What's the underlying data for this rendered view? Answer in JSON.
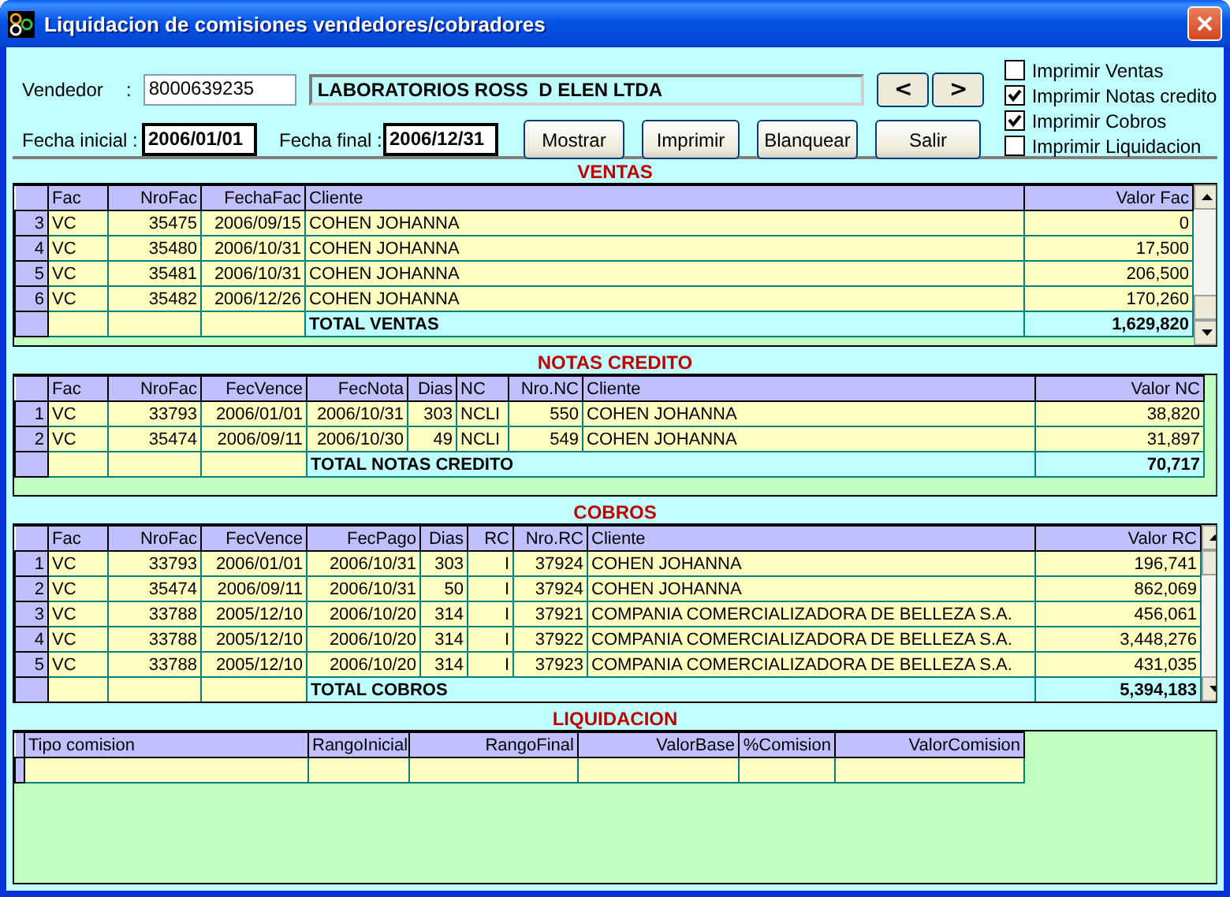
{
  "window": {
    "title": "Liquidacion de comisiones vendedores/cobradores"
  },
  "filters": {
    "vendedor_label": "Vendedor",
    "vendedor_colon": ":",
    "vendedor_code": "8000639235",
    "vendedor_name": "LABORATORIOS ROSS  D ELEN LTDA",
    "prev_button": "<",
    "next_button": ">",
    "fecha_inicial_label": "Fecha inicial  :",
    "fecha_inicial": "2006/01/01",
    "fecha_final_label": "Fecha final :",
    "fecha_final": "2006/12/31"
  },
  "buttons": [
    "Mostrar",
    "Imprimir",
    "Blanquear",
    "Salir"
  ],
  "options": [
    {
      "label": "Imprimir Ventas",
      "checked": false
    },
    {
      "label": "Imprimir Notas credito",
      "checked": true
    },
    {
      "label": "Imprimir Cobros",
      "checked": true
    },
    {
      "label": "Imprimir Liquidacion",
      "checked": false
    }
  ],
  "grids": [
    {
      "title": "VENTAS",
      "scrollbar": true,
      "columns": [
        {
          "label": "Fac",
          "kind": "text"
        },
        {
          "label": "NroFac",
          "kind": "number"
        },
        {
          "label": "FechaFac",
          "kind": "number"
        },
        {
          "label": "Cliente",
          "kind": "text",
          "total_label": true
        },
        {
          "label": "Valor Fac",
          "kind": "number"
        }
      ],
      "rows": [
        {
          "row_header": "3",
          "cells": [
            "VC",
            "35475",
            "2006/09/15",
            "COHEN JOHANNA",
            "0"
          ]
        },
        {
          "row_header": "4",
          "cells": [
            "VC",
            "35480",
            "2006/10/31",
            "COHEN JOHANNA",
            "17,500"
          ]
        },
        {
          "row_header": "5",
          "cells": [
            "VC",
            "35481",
            "2006/10/31",
            "COHEN JOHANNA",
            "206,500"
          ]
        },
        {
          "row_header": "6",
          "cells": [
            "VC",
            "35482",
            "2006/12/26",
            "COHEN JOHANNA",
            "170,260"
          ]
        }
      ],
      "total": {
        "label": "TOTAL VENTAS",
        "value": "1,629,820"
      }
    },
    {
      "title": "NOTAS CREDITO",
      "scrollbar": false,
      "columns": [
        {
          "label": "Fac",
          "kind": "text"
        },
        {
          "label": "NroFac",
          "kind": "number"
        },
        {
          "label": "FecVence",
          "kind": "number"
        },
        {
          "label": "FecNota",
          "kind": "number",
          "total_label": true
        },
        {
          "label": "Dias",
          "kind": "number"
        },
        {
          "label": "NC",
          "kind": "text"
        },
        {
          "label": "Nro.NC",
          "kind": "number"
        },
        {
          "label": "Cliente",
          "kind": "text"
        },
        {
          "label": "Valor NC",
          "kind": "number"
        }
      ],
      "rows": [
        {
          "row_header": "1",
          "cells": [
            "VC",
            "33793",
            "2006/01/01",
            "2006/10/31",
            "303",
            "NCLI",
            "550",
            "COHEN JOHANNA",
            "38,820"
          ]
        },
        {
          "row_header": "2",
          "cells": [
            "VC",
            "35474",
            "2006/09/11",
            "2006/10/30",
            "49",
            "NCLI",
            "549",
            "COHEN JOHANNA",
            "31,897"
          ]
        }
      ],
      "total": {
        "label": "TOTAL NOTAS CREDITO",
        "value": "70,717"
      }
    },
    {
      "title": "COBROS",
      "scrollbar": true,
      "columns": [
        {
          "label": "Fac",
          "kind": "text"
        },
        {
          "label": "NroFac",
          "kind": "number"
        },
        {
          "label": "FecVence",
          "kind": "number"
        },
        {
          "label": "FecPago",
          "kind": "number",
          "total_label": true
        },
        {
          "label": "Dias",
          "kind": "number"
        },
        {
          "label": "RC",
          "kind": "number"
        },
        {
          "label": "Nro.RC",
          "kind": "number"
        },
        {
          "label": "Cliente",
          "kind": "text"
        },
        {
          "label": "Valor RC",
          "kind": "number"
        }
      ],
      "rows": [
        {
          "row_header": "1",
          "cells": [
            "VC",
            "33793",
            "2006/01/01",
            "2006/10/31",
            "303",
            "I",
            "37924",
            "COHEN JOHANNA",
            "196,741"
          ]
        },
        {
          "row_header": "2",
          "cells": [
            "VC",
            "35474",
            "2006/09/11",
            "2006/10/31",
            "50",
            "I",
            "37924",
            "COHEN JOHANNA",
            "862,069"
          ]
        },
        {
          "row_header": "3",
          "cells": [
            "VC",
            "33788",
            "2005/12/10",
            "2006/10/20",
            "314",
            "I",
            "37921",
            "COMPANIA COMERCIALIZADORA DE BELLEZA S.A.",
            "456,061"
          ]
        },
        {
          "row_header": "4",
          "cells": [
            "VC",
            "33788",
            "2005/12/10",
            "2006/10/20",
            "314",
            "I",
            "37922",
            "COMPANIA COMERCIALIZADORA DE BELLEZA S.A.",
            "3,448,276"
          ]
        },
        {
          "row_header": "5",
          "cells": [
            "VC",
            "33788",
            "2005/12/10",
            "2006/10/20",
            "314",
            "I",
            "37923",
            "COMPANIA COMERCIALIZADORA DE BELLEZA S.A.",
            "431,035"
          ]
        }
      ],
      "total": {
        "label": "TOTAL COBROS",
        "value": "5,394,183"
      }
    },
    {
      "title": "LIQUIDACION",
      "scrollbar": false,
      "columns": [
        {
          "label": "Tipo comision",
          "kind": "text"
        },
        {
          "label": "RangoInicial",
          "kind": "number"
        },
        {
          "label": "RangoFinal",
          "kind": "number"
        },
        {
          "label": "ValorBase",
          "kind": "number"
        },
        {
          "label": "%Comision",
          "kind": "number"
        },
        {
          "label": "ValorComision",
          "kind": "number"
        }
      ]
    }
  ]
}
